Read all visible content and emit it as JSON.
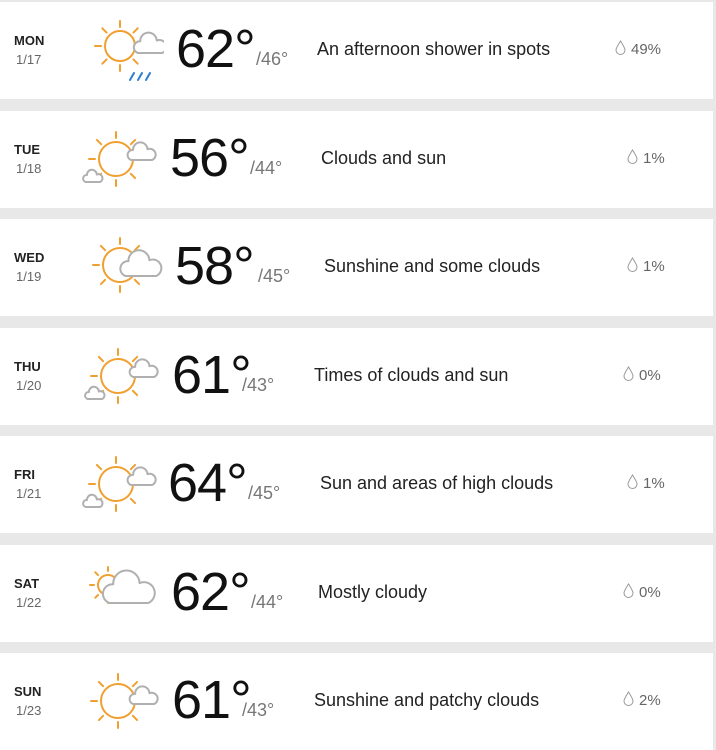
{
  "colors": {
    "sun": "#f0a030",
    "cloud": "#b0b0b0",
    "rain": "#2a7fd0"
  },
  "days": [
    {
      "day": "MON",
      "date": "1/17",
      "high": "62°",
      "low": "/46°",
      "desc": "An afternoon shower in spots",
      "precip": "49%",
      "icon": "partly-cloudy-showers-icon"
    },
    {
      "day": "TUE",
      "date": "1/18",
      "high": "56°",
      "low": "/44°",
      "desc": "Clouds and sun",
      "precip": "1%",
      "icon": "partly-sunny-icon"
    },
    {
      "day": "WED",
      "date": "1/19",
      "high": "58°",
      "low": "/45°",
      "desc": "Sunshine and some clouds",
      "precip": "1%",
      "icon": "sun-cloud-icon"
    },
    {
      "day": "THU",
      "date": "1/20",
      "high": "61°",
      "low": "/43°",
      "desc": "Times of clouds and sun",
      "precip": "0%",
      "icon": "partly-sunny-icon"
    },
    {
      "day": "FRI",
      "date": "1/21",
      "high": "64°",
      "low": "/45°",
      "desc": "Sun and areas of high clouds",
      "precip": "1%",
      "icon": "partly-sunny-icon"
    },
    {
      "day": "SAT",
      "date": "1/22",
      "high": "62°",
      "low": "/44°",
      "desc": "Mostly cloudy",
      "precip": "0%",
      "icon": "mostly-cloudy-icon"
    },
    {
      "day": "SUN",
      "date": "1/23",
      "high": "61°",
      "low": "/43°",
      "desc": "Sunshine and patchy clouds",
      "precip": "2%",
      "icon": "mostly-sunny-icon"
    }
  ]
}
